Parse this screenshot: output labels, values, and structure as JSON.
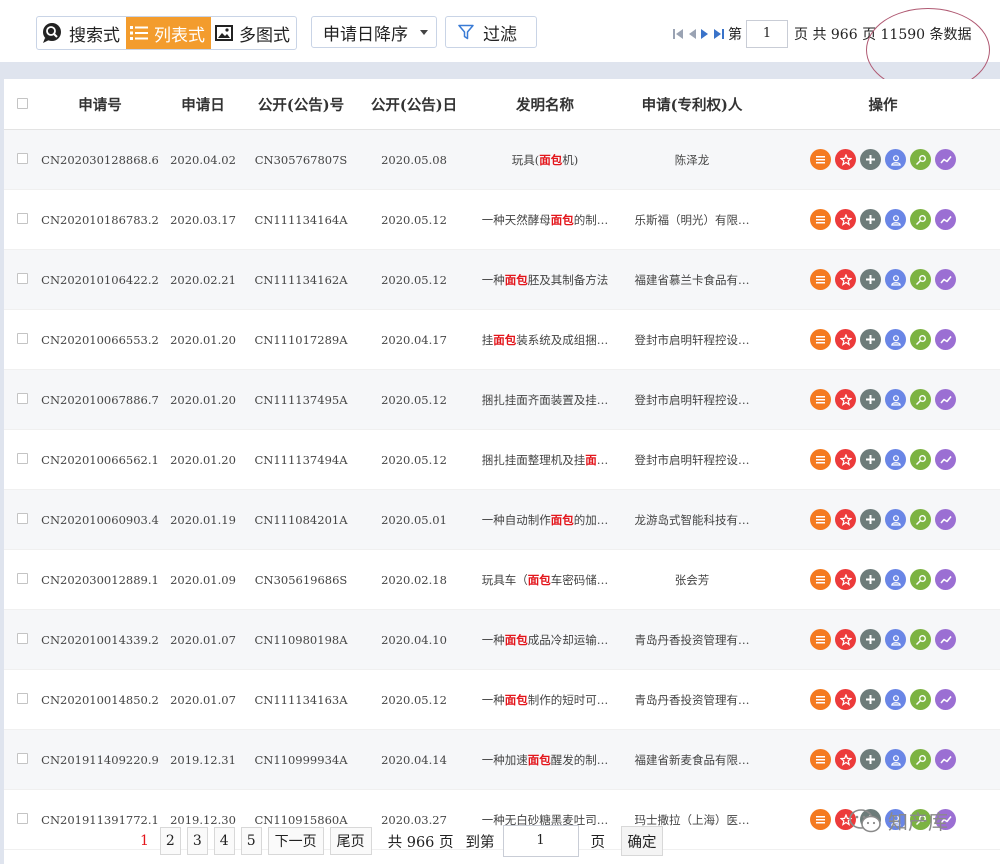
{
  "toolbar": {
    "views": [
      {
        "label": "搜索式",
        "icon": "search-bubble-icon",
        "active": false
      },
      {
        "label": "列表式",
        "icon": "list-icon",
        "active": true
      },
      {
        "label": "多图式",
        "icon": "image-icon",
        "active": false
      }
    ],
    "sort_label": "申请日降序",
    "filter_label": "过滤"
  },
  "pager_top": {
    "prefix": "第",
    "current": "1",
    "summary": "页 共 966 页 11590 条数据"
  },
  "table": {
    "headers": [
      "申请号",
      "申请日",
      "公开(公告)号",
      "公开(公告)日",
      "发明名称",
      "申请(专利权)人",
      "操作"
    ],
    "rows": [
      {
        "app_no": "CN202030128868.6",
        "app_date": "2020.04.02",
        "pub_no": "CN305767807S",
        "pub_date": "2020.05.08",
        "title_pre": "玩具(",
        "title_hl": "面包",
        "title_post": "机)",
        "applicant": "陈泽龙"
      },
      {
        "app_no": "CN202010186783.2",
        "app_date": "2020.03.17",
        "pub_no": "CN111134164A",
        "pub_date": "2020.05.12",
        "title_pre": "一种天然酵母",
        "title_hl": "面包",
        "title_post": "的制…",
        "applicant": "乐斯福（明光）有限…"
      },
      {
        "app_no": "CN202010106422.2",
        "app_date": "2020.02.21",
        "pub_no": "CN111134162A",
        "pub_date": "2020.05.12",
        "title_pre": "一种",
        "title_hl": "面包",
        "title_post": "胚及其制备方法",
        "applicant": "福建省慕兰卡食品有…"
      },
      {
        "app_no": "CN202010066553.2",
        "app_date": "2020.01.20",
        "pub_no": "CN111017289A",
        "pub_date": "2020.04.17",
        "title_pre": "挂",
        "title_hl": "面包",
        "title_post": "装系统及成组捆…",
        "applicant": "登封市启明轩程控设…"
      },
      {
        "app_no": "CN202010067886.7",
        "app_date": "2020.01.20",
        "pub_no": "CN111137495A",
        "pub_date": "2020.05.12",
        "title_pre": "捆扎挂面齐面装置及挂…",
        "title_hl": "",
        "title_post": "",
        "applicant": "登封市启明轩程控设…"
      },
      {
        "app_no": "CN202010066562.1",
        "app_date": "2020.01.20",
        "pub_no": "CN111137494A",
        "pub_date": "2020.05.12",
        "title_pre": "捆扎挂面整理机及挂",
        "title_hl": "面",
        "title_post": "…",
        "applicant": "登封市启明轩程控设…"
      },
      {
        "app_no": "CN202010060903.4",
        "app_date": "2020.01.19",
        "pub_no": "CN111084201A",
        "pub_date": "2020.05.01",
        "title_pre": "一种自动制作",
        "title_hl": "面包",
        "title_post": "的加…",
        "applicant": "龙游岛式智能科技有…"
      },
      {
        "app_no": "CN202030012889.1",
        "app_date": "2020.01.09",
        "pub_no": "CN305619686S",
        "pub_date": "2020.02.18",
        "title_pre": "玩具车（",
        "title_hl": "面包",
        "title_post": "车密码储…",
        "applicant": "张会芳"
      },
      {
        "app_no": "CN202010014339.2",
        "app_date": "2020.01.07",
        "pub_no": "CN110980198A",
        "pub_date": "2020.04.10",
        "title_pre": "一种",
        "title_hl": "面包",
        "title_post": "成品冷却运输…",
        "applicant": "青岛丹香投资管理有…"
      },
      {
        "app_no": "CN202010014850.2",
        "app_date": "2020.01.07",
        "pub_no": "CN111134163A",
        "pub_date": "2020.05.12",
        "title_pre": "一种",
        "title_hl": "面包",
        "title_post": "制作的短时可…",
        "applicant": "青岛丹香投资管理有…"
      },
      {
        "app_no": "CN201911409220.9",
        "app_date": "2019.12.31",
        "pub_no": "CN110999934A",
        "pub_date": "2020.04.14",
        "title_pre": "一种加速",
        "title_hl": "面包",
        "title_post": "醒发的制…",
        "applicant": "福建省新麦食品有限…"
      },
      {
        "app_no": "CN201911391772.1",
        "app_date": "2019.12.30",
        "pub_no": "CN110915860A",
        "pub_date": "2020.03.27",
        "title_pre": "一种无白砂糖黑麦吐司…",
        "title_hl": "",
        "title_post": "",
        "applicant": "玛士撒拉（上海）医…"
      }
    ],
    "actions": [
      {
        "icon": "list-detail-icon",
        "color": "#f47a20"
      },
      {
        "icon": "star-icon",
        "color": "#ec3b3b"
      },
      {
        "icon": "plus-icon",
        "color": "#6d7c7a"
      },
      {
        "icon": "user-icon",
        "color": "#6a86e6"
      },
      {
        "icon": "search-key-icon",
        "color": "#7cb342"
      },
      {
        "icon": "trend-icon",
        "color": "#9b6fd3"
      }
    ]
  },
  "pager_bottom": {
    "pages": [
      "1",
      "2",
      "3",
      "4",
      "5"
    ],
    "next": "下一页",
    "last": "尾页",
    "total": "共 966 页",
    "goto_label": "到第",
    "goto_value": "1",
    "page_unit": "页",
    "confirm": "确定"
  },
  "watermark": "知产库",
  "colors": {
    "accent": "#f39c2d",
    "highlight": "#e3151b",
    "background": "#dfe4ee",
    "annotation_circle": "#b05a73"
  }
}
